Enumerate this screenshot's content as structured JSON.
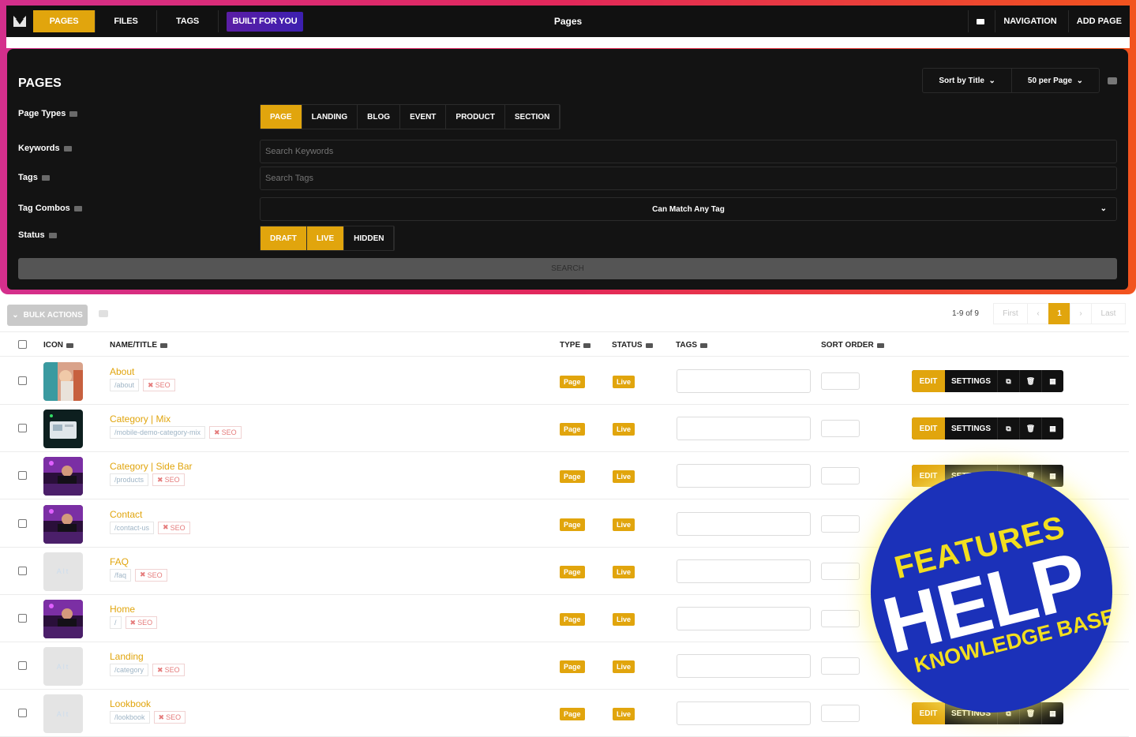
{
  "topbar": {
    "tabs": [
      {
        "label": "PAGES",
        "active": true
      },
      {
        "label": "FILES",
        "active": false
      },
      {
        "label": "TAGS",
        "active": false
      }
    ],
    "built_for_you": "BUILT FOR YOU",
    "title": "Pages",
    "navigation": "NAVIGATION",
    "add_page": "ADD PAGE"
  },
  "filters": {
    "heading": "PAGES",
    "sort_by": "Sort by Title",
    "per_page": "50 per Page",
    "page_types_label": "Page Types",
    "page_types": [
      {
        "label": "PAGE",
        "on": true
      },
      {
        "label": "LANDING",
        "on": false
      },
      {
        "label": "BLOG",
        "on": false
      },
      {
        "label": "EVENT",
        "on": false
      },
      {
        "label": "PRODUCT",
        "on": false
      },
      {
        "label": "SECTION",
        "on": false
      }
    ],
    "keywords_label": "Keywords",
    "keywords_placeholder": "Search Keywords",
    "tags_label": "Tags",
    "tags_placeholder": "Search Tags",
    "tag_combos_label": "Tag Combos",
    "tag_combos_value": "Can Match Any Tag",
    "status_label": "Status",
    "status": [
      {
        "label": "DRAFT",
        "on": true
      },
      {
        "label": "LIVE",
        "on": true
      },
      {
        "label": "HIDDEN",
        "on": false
      }
    ],
    "search_button": "SEARCH"
  },
  "list": {
    "bulk_actions": "BULK ACTIONS",
    "count": "1-9 of 9",
    "pager": {
      "first": "First",
      "prev": "‹",
      "current": "1",
      "next": "›",
      "last": "Last"
    },
    "columns": {
      "icon": "ICON",
      "name": "NAME/TITLE",
      "type": "TYPE",
      "status": "STATUS",
      "tags": "TAGS",
      "sort_order": "SORT ORDER"
    },
    "row_actions": {
      "edit": "EDIT",
      "settings": "SETTINGS"
    },
    "seo_label": "SEO",
    "rows": [
      {
        "name": "About",
        "slug": "/about",
        "type": "Page",
        "status": "Live",
        "thumb": "photo-warm"
      },
      {
        "name": "Category | Mix",
        "slug": "/mobile-demo-category-mix",
        "type": "Page",
        "status": "Live",
        "thumb": "photo-tablet"
      },
      {
        "name": "Category | Side Bar",
        "slug": "/products",
        "type": "Page",
        "status": "Live",
        "thumb": "photo-dj"
      },
      {
        "name": "Contact",
        "slug": "/contact-us",
        "type": "Page",
        "status": "Live",
        "thumb": "photo-dj"
      },
      {
        "name": "FAQ",
        "slug": "/faq",
        "type": "Page",
        "status": "Live",
        "thumb": "placeholder"
      },
      {
        "name": "Home",
        "slug": "/",
        "type": "Page",
        "status": "Live",
        "thumb": "photo-dj"
      },
      {
        "name": "Landing",
        "slug": "/category",
        "type": "Page",
        "status": "Live",
        "thumb": "placeholder"
      },
      {
        "name": "Lookbook",
        "slug": "/lookbook",
        "type": "Page",
        "status": "Live",
        "thumb": "placeholder"
      }
    ],
    "thumb_alt": "Alt"
  },
  "help_badge": {
    "line1": "FEATURES",
    "line2": "HELP",
    "line3": "KNOWLEDGE BASE"
  },
  "colors": {
    "accent": "#e1a50d",
    "dark": "#111111",
    "badge_blue": "#1b31b9",
    "badge_yellow": "#f2df1f"
  }
}
